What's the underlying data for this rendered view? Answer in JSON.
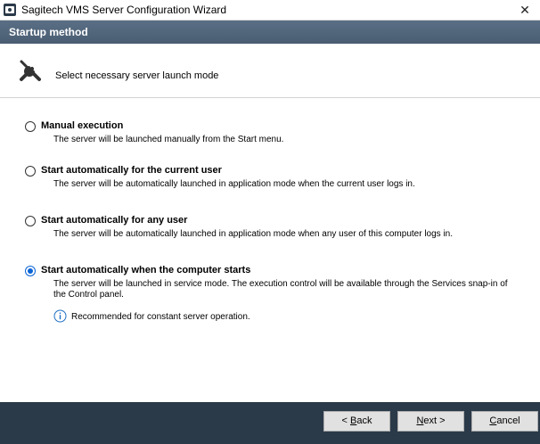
{
  "window": {
    "title": "Sagitech VMS Server Configuration Wizard",
    "close_glyph": "✕"
  },
  "header": {
    "title": "Startup method"
  },
  "subheader": {
    "icon": "tools-icon",
    "text": "Select necessary server launch mode"
  },
  "options": [
    {
      "label": "Manual execution",
      "description": "The server will be launched manually from the Start menu.",
      "selected": false
    },
    {
      "label": "Start automatically for the current user",
      "description": "The server will be automatically launched in application mode when the current user logs in.",
      "selected": false
    },
    {
      "label": "Start automatically for any user",
      "description": "The server will be automatically launched in application mode when any user of this computer logs in.",
      "selected": false
    },
    {
      "label": "Start automatically when the computer starts",
      "description": "The server will be launched in service mode. The execution control will be available through the Services snap-in of the Control panel.",
      "selected": true,
      "note": "Recommended for constant server operation."
    }
  ],
  "buttons": {
    "back": {
      "accel": "B",
      "rest": "ack",
      "prefix": "< "
    },
    "next": {
      "accel": "N",
      "rest": "ext >"
    },
    "cancel": {
      "accel": "C",
      "rest": "ancel"
    }
  },
  "colors": {
    "header_band": "#4f6378",
    "footer": "#2b3a49",
    "radio_selected": "#0a64d6"
  }
}
